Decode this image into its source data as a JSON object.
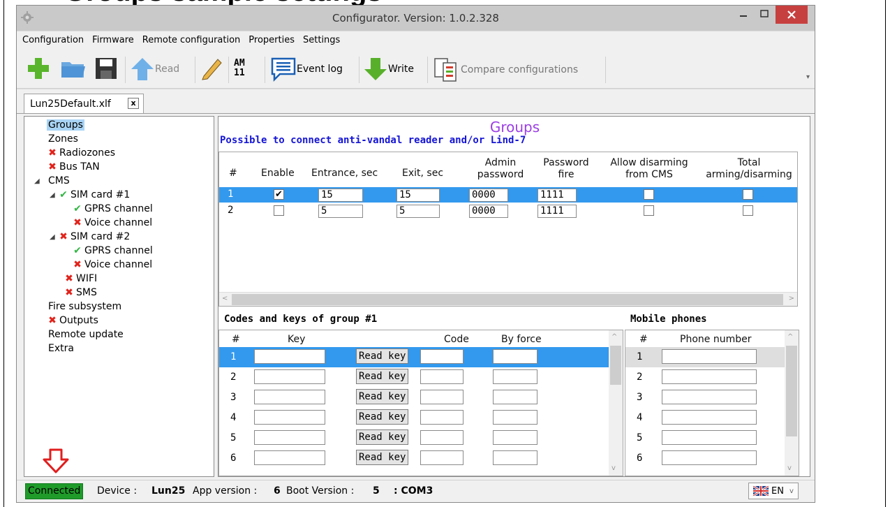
{
  "doc_heading": "Groups sample settings",
  "window": {
    "title": "Configurator. Version: 1.0.2.328"
  },
  "menu": [
    "Configuration",
    "Firmware",
    "Remote configuration",
    "Properties",
    "Settings"
  ],
  "toolbar": {
    "read_label": "Read",
    "am_top": "AM",
    "am_bottom": "11",
    "event_log_label": "Event log",
    "write_label": "Write",
    "compare_label": "Compare configurations",
    "icons": [
      "add-icon",
      "open-folder-icon",
      "save-icon",
      "read-arrow-icon",
      "edit-pencil-icon",
      "event-log-icon",
      "write-arrow-icon",
      "compare-icon"
    ]
  },
  "tabs": {
    "doc_tab": "Lun25Default.xlf",
    "close": "x"
  },
  "tree": [
    {
      "label": "Groups",
      "mark": "",
      "selected": true
    },
    {
      "label": "Zones",
      "mark": ""
    },
    {
      "label": "Radiozones",
      "mark": "x"
    },
    {
      "label": "Bus TAN",
      "mark": "x"
    },
    {
      "label": "CMS",
      "mark": "",
      "expanded": true
    },
    {
      "label": "SIM card #1",
      "mark": "ok",
      "expanded": true
    },
    {
      "label": "GPRS channel",
      "mark": "ok"
    },
    {
      "label": "Voice channel",
      "mark": "x"
    },
    {
      "label": "SIM card #2",
      "mark": "x",
      "expanded": true
    },
    {
      "label": "GPRS channel",
      "mark": "ok"
    },
    {
      "label": "Voice channel",
      "mark": "x"
    },
    {
      "label": "WIFI",
      "mark": "x"
    },
    {
      "label": "SMS",
      "mark": "x"
    },
    {
      "label": "Fire subsystem",
      "mark": ""
    },
    {
      "label": "Outputs",
      "mark": "x"
    },
    {
      "label": "Remote update",
      "mark": ""
    },
    {
      "label": "Extra",
      "mark": ""
    }
  ],
  "groups": {
    "title": "Groups",
    "subtitle": "Possible to connect anti-vandal reader and/or Lind-7",
    "headers": [
      "#",
      "Enable",
      "Entrance, sec",
      "Exit, sec",
      "Admin password",
      "Password fire",
      "Allow disarming from CMS",
      "Total arming/disarming"
    ],
    "headers_2line": {
      "admin": [
        "Admin",
        "password"
      ],
      "pfire": [
        "Password",
        "fire"
      ],
      "allow": [
        "Allow disarming",
        "from CMS"
      ],
      "total": [
        "Total",
        "arming/disarming"
      ]
    },
    "rows": [
      {
        "num": "1",
        "enable": true,
        "entrance": "15",
        "exit": "15",
        "admin": "0000",
        "fire": "1111",
        "allow_disarm": false,
        "total": false,
        "selected": true
      },
      {
        "num": "2",
        "enable": false,
        "entrance": "5",
        "exit": "5",
        "admin": "0000",
        "fire": "1111",
        "allow_disarm": false,
        "total": false,
        "selected": false
      }
    ]
  },
  "codes": {
    "title": "Codes and keys of group #1",
    "headers": [
      "#",
      "Key",
      "Code",
      "By force"
    ],
    "read_key_label": "Read key",
    "rows": [
      "1",
      "2",
      "3",
      "4",
      "5",
      "6"
    ]
  },
  "phones": {
    "title": "Mobile phones",
    "headers": [
      "#",
      "Phone number"
    ],
    "rows": [
      "1",
      "2",
      "3",
      "4",
      "5",
      "6"
    ]
  },
  "status": {
    "connected": "Connected",
    "device_label": "Device :",
    "device_value": "Lun25",
    "app_label": "App version :",
    "app_value": "6",
    "boot_label": "Boot Version :",
    "boot_value": "5",
    "port": ": COM3",
    "language": "EN"
  },
  "colors": {
    "selection": "#3399ee",
    "groups_title": "#9b3ee6",
    "subtitle": "#1515d6",
    "connected_bg": "#1f9b2a",
    "error_mark": "#e0231b",
    "ok_mark": "#33b544"
  }
}
